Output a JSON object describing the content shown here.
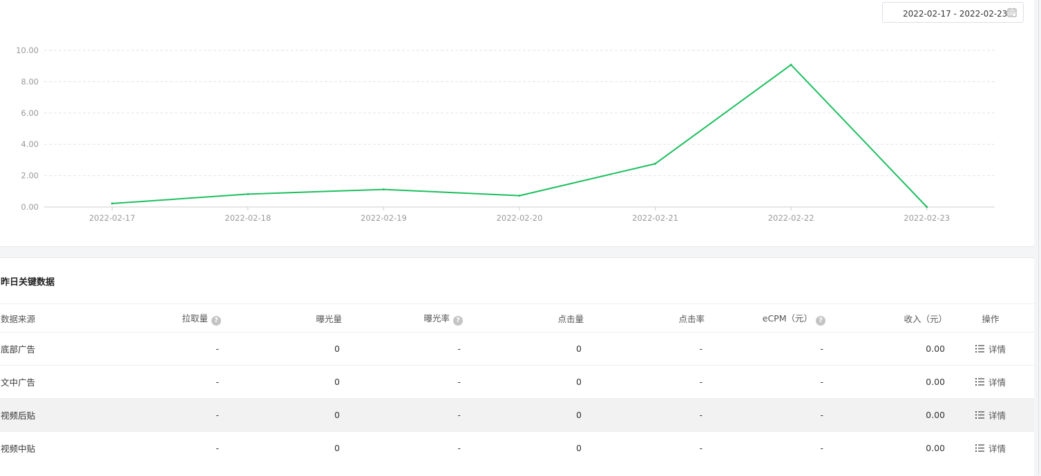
{
  "date_range": {
    "text": "2022-02-17 - 2022-02-23",
    "icon": "calendar-icon"
  },
  "chart_data": {
    "type": "line",
    "x": [
      "2022-02-17",
      "2022-02-18",
      "2022-02-19",
      "2022-02-20",
      "2022-02-21",
      "2022-02-22",
      "2022-02-23"
    ],
    "series": [
      {
        "values": [
          0.22,
          0.82,
          1.12,
          0.72,
          2.76,
          9.08,
          0.0
        ],
        "color": "#1bbf5e"
      }
    ],
    "ylim": [
      0,
      10
    ],
    "yticks": [
      "0.00",
      "2.00",
      "4.00",
      "6.00",
      "8.00",
      "10.00"
    ],
    "grid": true
  },
  "section": {
    "title": "昨日关键数据"
  },
  "table": {
    "headers": [
      {
        "label": "数据来源",
        "help": false
      },
      {
        "label": "拉取量",
        "help": true
      },
      {
        "label": "曝光量",
        "help": false
      },
      {
        "label": "曝光率",
        "help": true
      },
      {
        "label": "点击量",
        "help": false
      },
      {
        "label": "点击率",
        "help": false
      },
      {
        "label": "eCPM（元）",
        "help": true
      },
      {
        "label": "收入（元）",
        "help": false
      },
      {
        "label": "操作",
        "help": false
      }
    ],
    "rows": [
      {
        "source": "底部广告",
        "pull": "-",
        "impressions": "0",
        "imp_rate": "-",
        "clicks": "0",
        "ctr": "-",
        "ecpm": "-",
        "revenue": "0.00",
        "action": "详情"
      },
      {
        "source": "文中广告",
        "pull": "-",
        "impressions": "0",
        "imp_rate": "-",
        "clicks": "0",
        "ctr": "-",
        "ecpm": "-",
        "revenue": "0.00",
        "action": "详情"
      },
      {
        "source": "视频后贴",
        "pull": "-",
        "impressions": "0",
        "imp_rate": "-",
        "clicks": "0",
        "ctr": "-",
        "ecpm": "-",
        "revenue": "0.00",
        "action": "详情"
      },
      {
        "source": "视频中贴",
        "pull": "-",
        "impressions": "0",
        "imp_rate": "-",
        "clicks": "0",
        "ctr": "-",
        "ecpm": "-",
        "revenue": "0.00",
        "action": "详情"
      }
    ]
  },
  "colors": {
    "accent": "#1bbf5e",
    "row_highlight": "#f2f2f2"
  }
}
